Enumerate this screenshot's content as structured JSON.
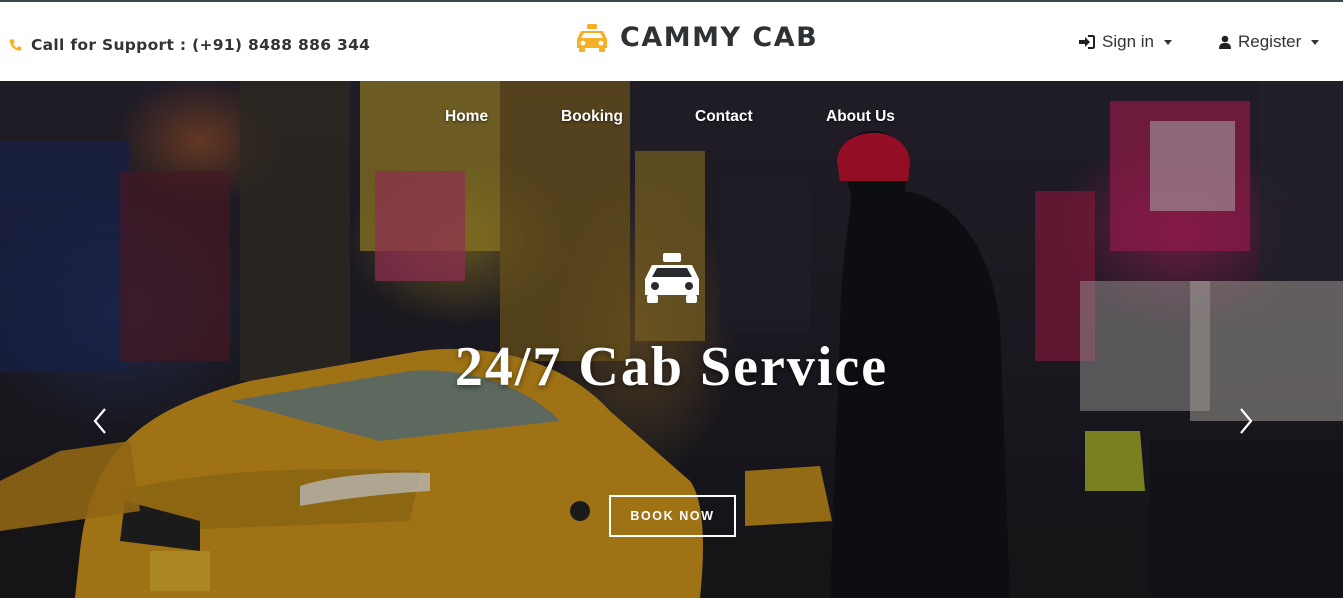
{
  "header": {
    "support_text": "Call for Support : (+91) 8488 886 344",
    "brand_name": "CAMMY CAB",
    "signin_label": "Sign in",
    "register_label": "Register"
  },
  "nav": {
    "items": [
      {
        "label": "Home"
      },
      {
        "label": "Booking"
      },
      {
        "label": "Contact"
      },
      {
        "label": "About Us"
      }
    ]
  },
  "hero": {
    "headline": "24/7 Cab Service",
    "cta_label": "BOOK NOW"
  },
  "icons": {
    "phone": "phone-icon",
    "brand_logo": "taxi-icon",
    "signin": "sign-in-icon",
    "register": "user-icon",
    "hero_icon": "taxi-icon",
    "prev": "chevron-left-icon",
    "next": "chevron-right-icon"
  },
  "colors": {
    "accent": "#f5b025",
    "brand_text": "#2f3235",
    "topline": "#3d4650"
  }
}
